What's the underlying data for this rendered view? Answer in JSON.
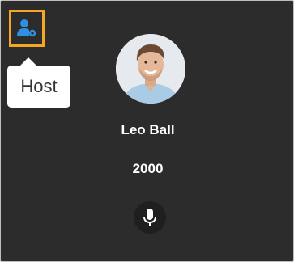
{
  "participant": {
    "name": "Leo Ball",
    "extension": "2000",
    "role_tooltip": "Host"
  },
  "icons": {
    "role": "host-user-icon",
    "mic": "microphone-icon"
  },
  "colors": {
    "tile_background": "#2c2c2c",
    "highlight_border": "#f5a623",
    "host_icon": "#2f8fe0",
    "text": "#ffffff"
  }
}
